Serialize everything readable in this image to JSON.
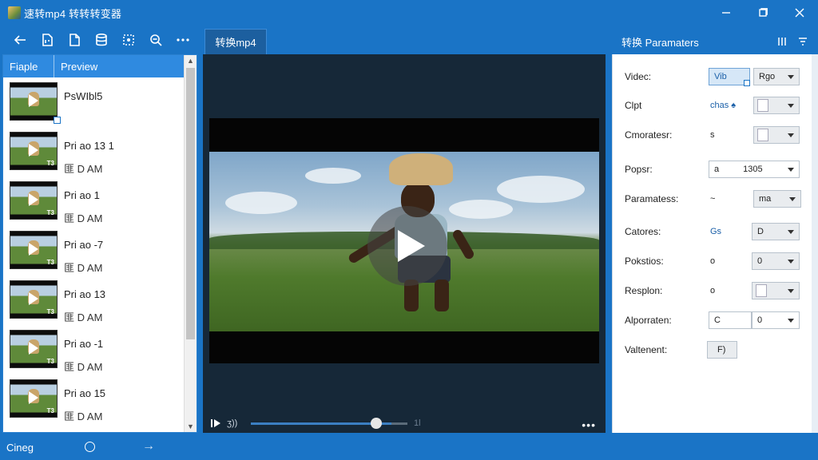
{
  "window": {
    "title": "速转mp4 转转转变器",
    "controls": [
      "minimize-icon",
      "maximize-icon",
      "close-icon"
    ]
  },
  "toolbar": {
    "buttons": [
      "back-arrow-icon",
      "zip-file-icon",
      "file-icon",
      "database-icon",
      "select-region-icon",
      "zoom-search-icon",
      "more-icon"
    ]
  },
  "file_list": {
    "columns": [
      "Fiaple",
      "Preview"
    ],
    "items": [
      {
        "name": "PsWIbl5",
        "date": "",
        "tag": ""
      },
      {
        "name": "Pri ao 13 1",
        "date": "匪 D AM",
        "tag": "T3"
      },
      {
        "name": "Pri ao 1",
        "date": "匪 D AM",
        "tag": "T3"
      },
      {
        "name": "Pri ao -7",
        "date": "匪 D AM",
        "tag": "T3"
      },
      {
        "name": "Pri ao 13",
        "date": "匪 D AM",
        "tag": "T3"
      },
      {
        "name": "Pri ao -1",
        "date": "匪 D AM",
        "tag": "T3"
      },
      {
        "name": "Pri ao 15",
        "date": "匪 D AM",
        "tag": "T3"
      }
    ]
  },
  "player": {
    "tab_label": "转换mp4",
    "current_time": "ʒ))",
    "end_time": "1l",
    "progress": 0.89,
    "more_label": "•••"
  },
  "params": {
    "header_title": "转换 Paramaters",
    "rows": [
      {
        "label": "Videc:",
        "value": "Vib",
        "control": "Rgo"
      },
      {
        "label": "Clpt",
        "value": "chas ♠",
        "control": ""
      },
      {
        "label": "Cmoratesr:",
        "value": "s",
        "control": ""
      },
      {
        "label": "Popsr:",
        "value": "a",
        "control": "1305"
      },
      {
        "label": "Paramatess:",
        "value": "~",
        "control": "ma"
      },
      {
        "label": "Catores:",
        "value": "Gs",
        "control": "D"
      },
      {
        "label": "Pokstios:",
        "value": "o",
        "control": "0"
      },
      {
        "label": "Resplon:",
        "value": "o",
        "control": ""
      },
      {
        "label": "Alporraten:",
        "value": "C",
        "control": "0"
      },
      {
        "label": "Valtenent:",
        "value": "",
        "control": "F)"
      }
    ]
  },
  "status": {
    "text": "Cineg",
    "arrow": "→"
  }
}
